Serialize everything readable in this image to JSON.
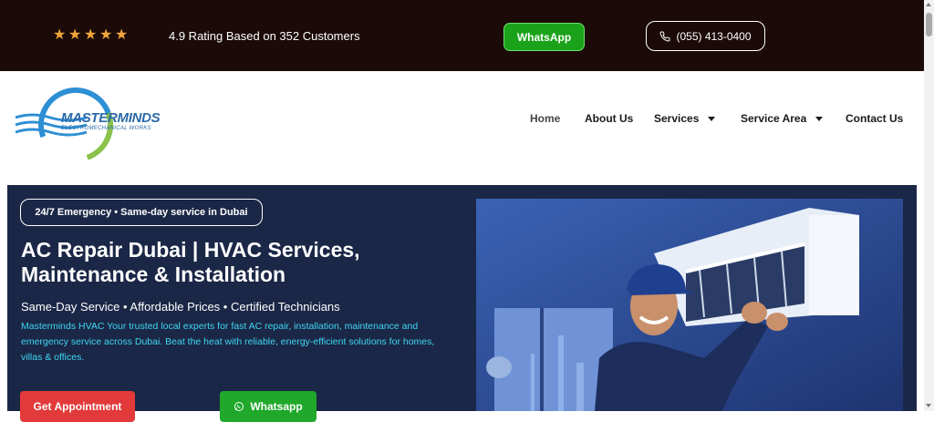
{
  "topbar": {
    "stars": 5,
    "star_color": "#f0a53a",
    "rating_text": "4.9 Rating Based on 352 Customers",
    "whatsapp_label": "WhatsApp",
    "phone_label": "(055) 413-0400",
    "background": "#1b0a08"
  },
  "header": {
    "logo": {
      "name": "MASTERMINDS",
      "tagline": "ELECTROMECHANICAL WORKS"
    },
    "nav": [
      {
        "label": "Home",
        "dropdown": false
      },
      {
        "label": "About Us",
        "dropdown": false
      },
      {
        "label": "Services",
        "dropdown": true
      },
      {
        "label": "Service Area",
        "dropdown": true
      },
      {
        "label": "Contact Us",
        "dropdown": false
      }
    ]
  },
  "hero": {
    "badge": "24/7 Emergency • Same-day service in Dubai",
    "title": "AC Repair Dubai | HVAC Services, Maintenance & Installation",
    "subtitle": "Same-Day Service • Affordable Prices • Certified Technicians",
    "description": "Masterminds HVAC  Your trusted local experts for fast AC repair, installation, maintenance and emergency service across Dubai. Beat the heat with reliable, energy-efficient solutions for homes, villas & offices.",
    "appointment_label": "Get Appointment",
    "whatsapp_label": "Whatsapp",
    "background": "#1b2746",
    "accent_text_color": "#3fd6f2"
  }
}
